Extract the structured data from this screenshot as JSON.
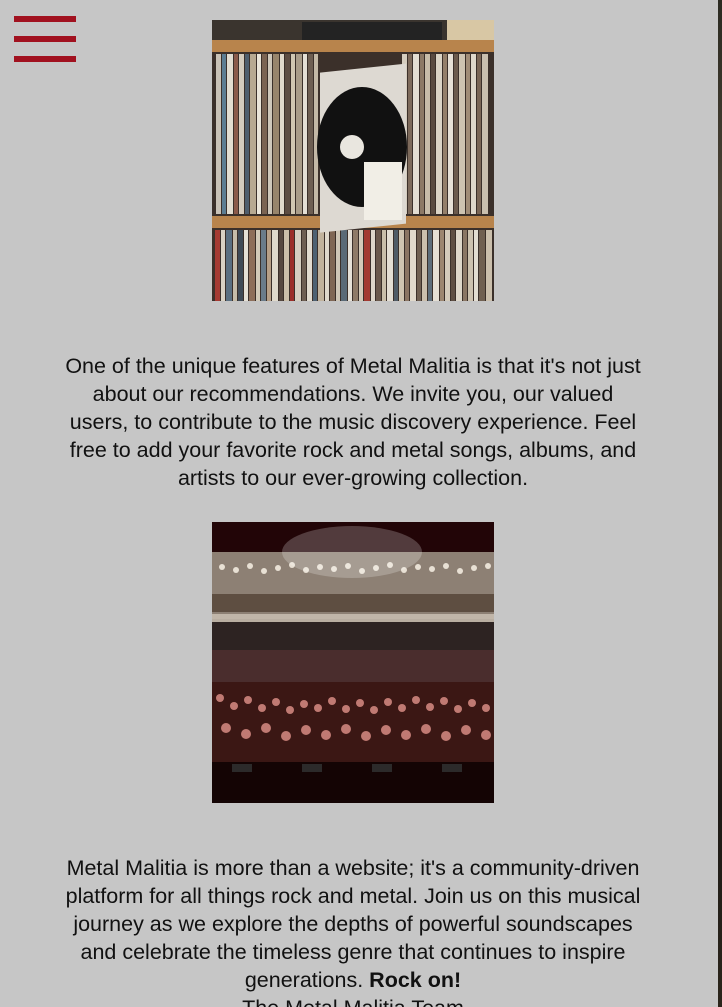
{
  "menu": {
    "icon": "hamburger-menu-icon",
    "color": "#a1111f"
  },
  "images": [
    {
      "name": "record-shelves-photo"
    },
    {
      "name": "concert-crowd-photo"
    }
  ],
  "content": {
    "paragraph1": "One of the unique features of Metal Malitia is that it's not just about our recommendations. We invite you, our valued users, to contribute to the music discovery experience. Feel free to add your favorite rock and metal songs, albums, and artists to our ever-growing collection.",
    "paragraph2": "Metal Malitia is more than a website; it's a community-driven platform for all things rock and metal. Join us on this musical journey as we explore the depths of powerful soundscapes and celebrate the timeless genre that continues to inspire generations.",
    "closing": "Rock on!",
    "signature": "The Metal Malitia Team"
  },
  "colors": {
    "background": "#c6c6c6",
    "accent": "#a1111f"
  }
}
